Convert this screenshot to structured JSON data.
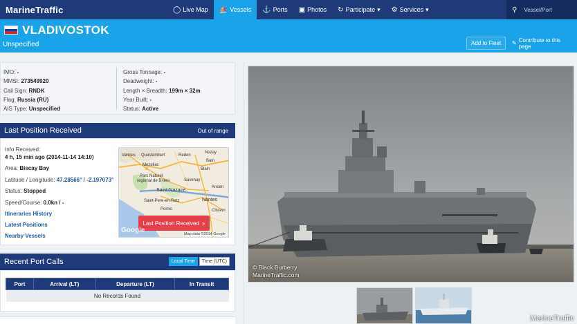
{
  "navbar": {
    "brand": "MarineTraffic",
    "items": [
      {
        "label": "Live Map",
        "icon": "globe-icon"
      },
      {
        "label": "Vessels",
        "icon": "ship-icon",
        "active": true
      },
      {
        "label": "Ports",
        "icon": "anchor-icon"
      },
      {
        "label": "Photos",
        "icon": "camera-icon"
      },
      {
        "label": "Participate",
        "icon": "refresh-icon",
        "dropdown": true
      },
      {
        "label": "Services",
        "icon": "gear-icon",
        "dropdown": true
      }
    ],
    "search_placeholder": "Vessel/Port"
  },
  "header": {
    "name": "VLADIVOSTOK",
    "type": "Unspecified",
    "add_fleet": "Add to Fleet",
    "contribute": "Contribute to this page",
    "flag_colors": [
      "#ffffff",
      "#1c3fa8",
      "#d52b1e"
    ]
  },
  "details": {
    "left": [
      {
        "label": "IMO:",
        "value": "-"
      },
      {
        "label": "MMSI:",
        "value": "273549920"
      },
      {
        "label": "Call Sign:",
        "value": "RNDK"
      },
      {
        "label": "Flag:",
        "value": "Russia (RU)"
      },
      {
        "label": "AIS Type:",
        "value": "Unspecified"
      }
    ],
    "right": [
      {
        "label": "Gross Tonnage:",
        "value": "-"
      },
      {
        "label": "Deadweight:",
        "value": "-"
      },
      {
        "label": "Length × Breadth:",
        "value": "199m × 32m"
      },
      {
        "label": "Year Built:",
        "value": "-"
      },
      {
        "label": "Status:",
        "value": "Active"
      }
    ]
  },
  "last_position": {
    "title": "Last Position Received",
    "range": "Out of range",
    "info_label": "Info Received:",
    "info_value": "4 h, 15 min ago (2014-11-14 14:10)",
    "area_label": "Area:",
    "area_value": "Biscay Bay",
    "latlon_label": "Latitude / Longitude:",
    "latlon_value": "47.28566° / -2.197073°",
    "status_label": "Status:",
    "status_value": "Stopped",
    "speed_label": "Speed/Course:",
    "speed_value": "0.0kn / -",
    "links": [
      "Itineraries History",
      "Latest Positions",
      "Nearby Vessels"
    ],
    "map": {
      "button": "Last Position Received",
      "google": "Google",
      "mapdata": "Map data ©2014 Google",
      "labels": [
        "Vannes",
        "Questembert",
        "Redon",
        "Nozay",
        "Bain",
        "Mezeliac",
        "Blain",
        "Parc Naturel",
        "régional de Brière",
        "Savenay",
        "Ancen",
        "Saint-Nazaire",
        "Nantes",
        "Pornic",
        "Saint-Pere-en-Retz",
        "Clisson"
      ]
    }
  },
  "port_calls": {
    "title": "Recent Port Calls",
    "local_time": "Local Time",
    "utc_time": "Time (UTC)",
    "columns": [
      "Port",
      "Arrival (LT)",
      "Departure (LT)",
      "In Transit"
    ],
    "empty": "No Records Found"
  },
  "photo": {
    "credit_line1": "© Black Burberry",
    "credit_line2": "MarineTraffic.com",
    "watermark": "MarineTraffic"
  }
}
